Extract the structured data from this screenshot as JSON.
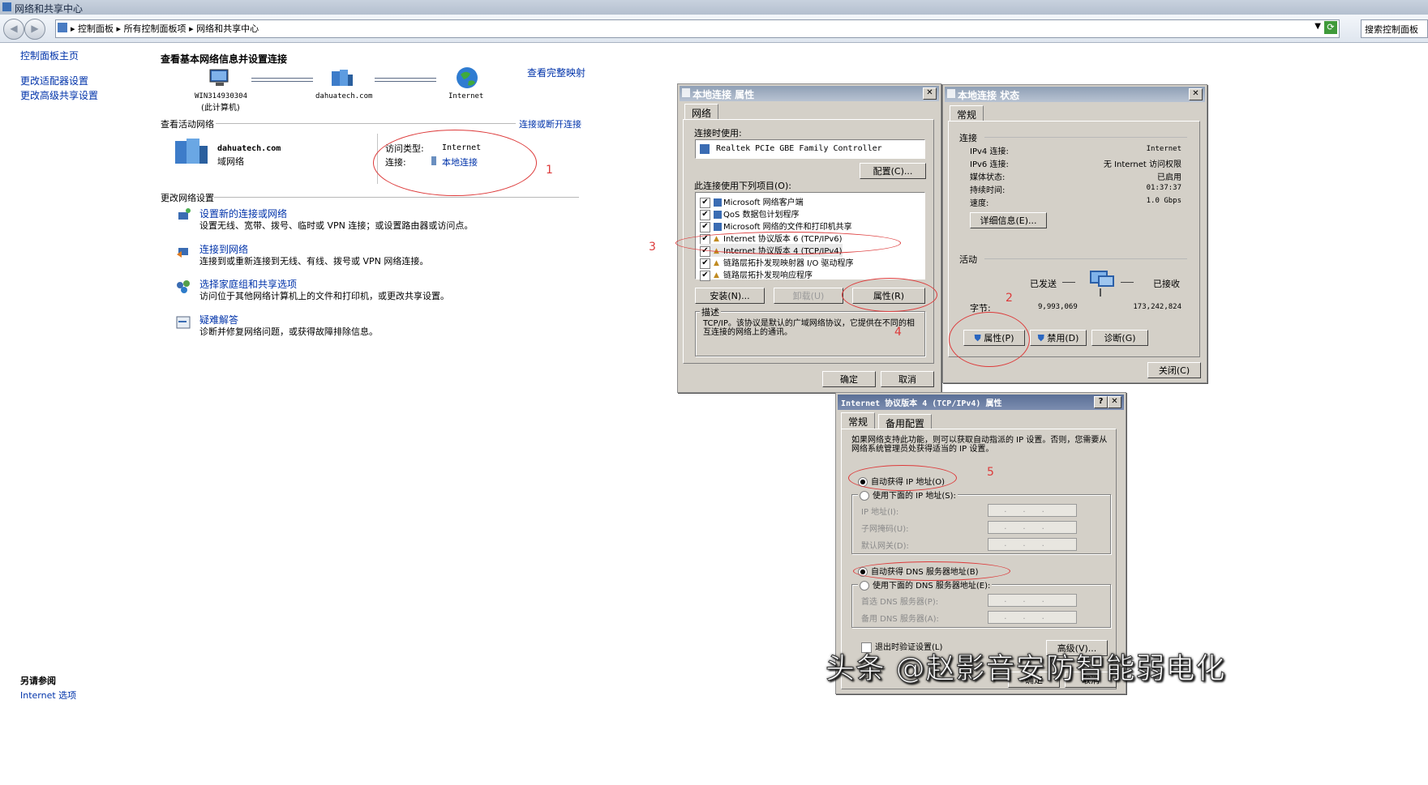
{
  "window": {
    "title": "网络和共享中心"
  },
  "nav": {
    "breadcrumb": [
      "控制面板",
      "所有控制面板项",
      "网络和共享中心"
    ],
    "search_placeholder": "搜索控制面板"
  },
  "sidebar": {
    "items": [
      {
        "label": "控制面板主页"
      },
      {
        "label": "更改适配器设置"
      },
      {
        "label": "更改高级共享设置"
      }
    ],
    "see_also_title": "另请参阅",
    "see_also_link": "Internet 选项"
  },
  "main": {
    "heading": "查看基本网络信息并设置连接",
    "view_full_map": "查看完整映射",
    "map_nodes": [
      {
        "label": "WIN314930304",
        "sub": "(此计算机)"
      },
      {
        "label": "dahuatech.com"
      },
      {
        "label": "Internet"
      }
    ],
    "active_networks_label": "查看活动网络",
    "connect_disconnect": "连接或断开连接",
    "network": {
      "name": "dahuatech.com",
      "type": "域网络"
    },
    "access_type_label": "访问类型:",
    "access_type_value": "Internet",
    "connection_label": "连接:",
    "connection_value": "本地连接",
    "change_settings_label": "更改网络设置",
    "tasks": [
      {
        "title": "设置新的连接或网络",
        "desc": "设置无线、宽带、拨号、临时或 VPN 连接；或设置路由器或访问点。"
      },
      {
        "title": "连接到网络",
        "desc": "连接到或重新连接到无线、有线、拨号或 VPN 网络连接。"
      },
      {
        "title": "选择家庭组和共享选项",
        "desc": "访问位于其他网络计算机上的文件和打印机，或更改共享设置。"
      },
      {
        "title": "疑难解答",
        "desc": "诊断并修复网络问题，或获得故障排除信息。"
      }
    ]
  },
  "props_dialog": {
    "title": "本地连接 属性",
    "tab": "网络",
    "connect_using_label": "连接时使用:",
    "adapter": "Realtek PCIe GBE Family Controller",
    "configure_btn": "配置(C)...",
    "items_label": "此连接使用下列项目(O):",
    "items": [
      "Microsoft 网络客户端",
      "QoS 数据包计划程序",
      "Microsoft 网络的文件和打印机共享",
      "Internet 协议版本 6 (TCP/IPv6)",
      "Internet 协议版本 4 (TCP/IPv4)",
      "链路层拓扑发现映射器 I/O 驱动程序",
      "链路层拓扑发现响应程序"
    ],
    "install_btn": "安装(N)...",
    "uninstall_btn": "卸载(U)",
    "properties_btn": "属性(R)",
    "description_label": "描述",
    "description": "TCP/IP。该协议是默认的广域网络协议，它提供在不同的相互连接的网络上的通讯。",
    "ok_btn": "确定",
    "cancel_btn": "取消"
  },
  "status_dialog": {
    "title": "本地连接 状态",
    "tab": "常规",
    "connection_section": "连接",
    "rows": [
      {
        "label": "IPv4 连接:",
        "value": "Internet"
      },
      {
        "label": "IPv6 连接:",
        "value": "无 Internet 访问权限"
      },
      {
        "label": "媒体状态:",
        "value": "已启用"
      },
      {
        "label": "持续时间:",
        "value": "01:37:37"
      },
      {
        "label": "速度:",
        "value": "1.0 Gbps"
      }
    ],
    "details_btn": "详细信息(E)...",
    "activity_section": "活动",
    "sent_label": "已发送",
    "received_label": "已接收",
    "bytes_label": "字节:",
    "bytes_sent": "9,993,069",
    "bytes_received": "173,242,824",
    "properties_btn": "属性(P)",
    "disable_btn": "禁用(D)",
    "diagnose_btn": "诊断(G)",
    "close_btn": "关闭(C)"
  },
  "ipv4_dialog": {
    "title": "Internet 协议版本 4 (TCP/IPv4) 属性",
    "tabs": [
      "常规",
      "备用配置"
    ],
    "intro": "如果网络支持此功能，则可以获取自动指派的 IP 设置。否则，您需要从网络系统管理员处获得适当的 IP 设置。",
    "auto_ip": "自动获得 IP 地址(O)",
    "manual_ip": "使用下面的 IP 地址(S):",
    "ip_address": "IP 地址(I):",
    "subnet_mask": "子网掩码(U):",
    "gateway": "默认网关(D):",
    "auto_dns": "自动获得 DNS 服务器地址(B)",
    "manual_dns": "使用下面的 DNS 服务器地址(E):",
    "preferred_dns": "首选 DNS 服务器(P):",
    "alternate_dns": "备用 DNS 服务器(A):",
    "validate": "退出时验证设置(L)",
    "advanced_btn": "高级(V)...",
    "ok_btn": "确定",
    "cancel_btn": "取消"
  },
  "annotations": [
    "1",
    "2",
    "3",
    "4",
    "5"
  ],
  "watermark": "头条 @赵影音安防智能弱电化"
}
